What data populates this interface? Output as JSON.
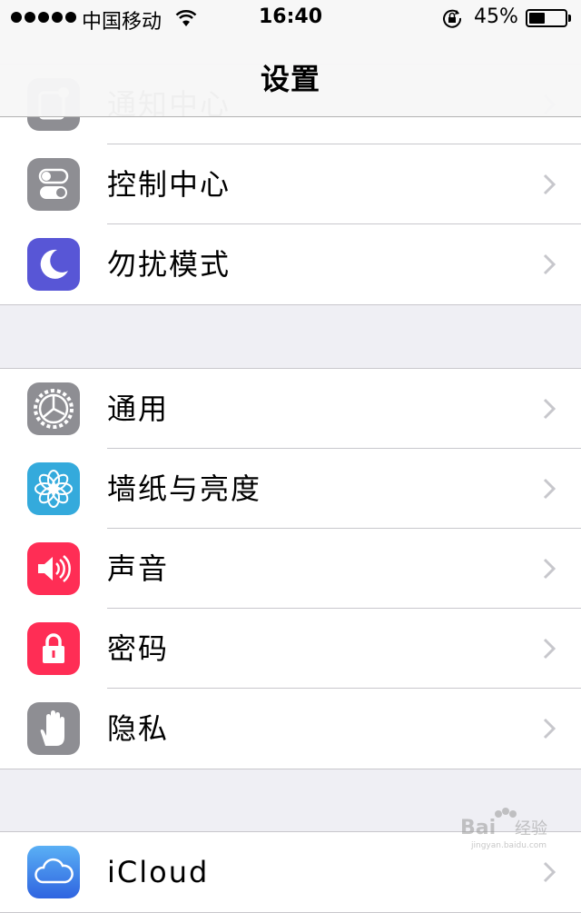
{
  "status_bar": {
    "carrier": "中国移动",
    "time": "16:40",
    "battery_percent": "45%",
    "battery_level": 0.45
  },
  "nav": {
    "title": "设置"
  },
  "groups": [
    {
      "items": [
        {
          "label": "通知中心",
          "icon": "notification-center-icon",
          "color": "#8e8e93"
        },
        {
          "label": "控制中心",
          "icon": "control-center-icon",
          "color": "#8e8e93"
        },
        {
          "label": "勿扰模式",
          "icon": "moon-icon",
          "color": "#5856d6"
        }
      ]
    },
    {
      "items": [
        {
          "label": "通用",
          "icon": "gear-icon",
          "color": "#8e8e93"
        },
        {
          "label": "墙纸与亮度",
          "icon": "flower-icon",
          "color": "#34aadc"
        },
        {
          "label": "声音",
          "icon": "speaker-icon",
          "color": "#ff2d55"
        },
        {
          "label": "密码",
          "icon": "lock-icon",
          "color": "#ff2d55"
        },
        {
          "label": "隐私",
          "icon": "hand-icon",
          "color": "#8e8e93"
        }
      ]
    },
    {
      "items": [
        {
          "label": "iCloud",
          "icon": "cloud-icon",
          "color": "#3d7ff0"
        }
      ]
    }
  ],
  "watermark": {
    "text": "Baidu经验",
    "subtext": "jingyan.baidu.com"
  }
}
